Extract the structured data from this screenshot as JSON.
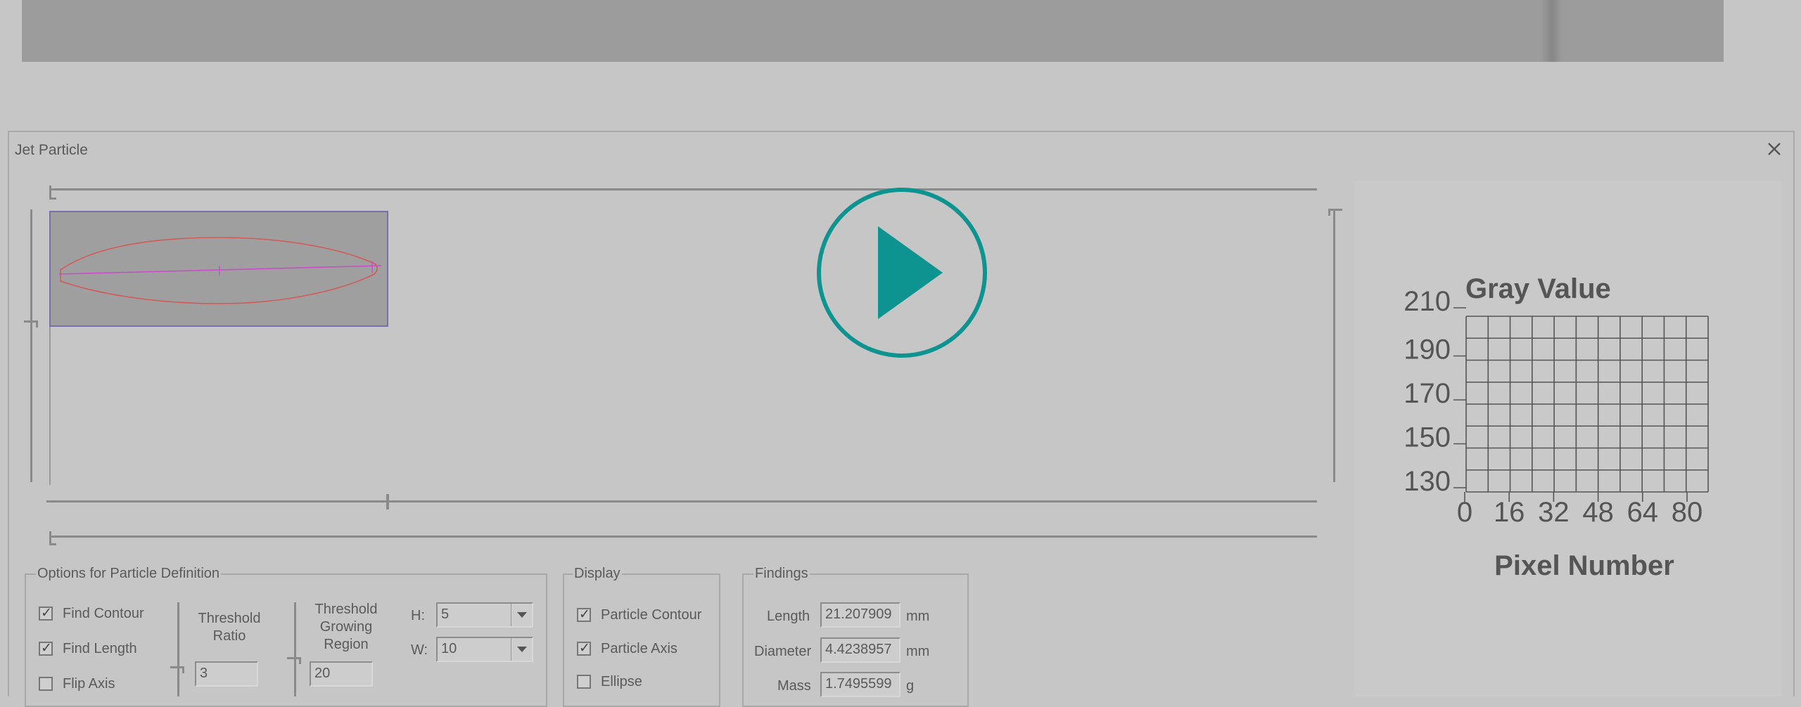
{
  "window": {
    "title": "Jet Particle"
  },
  "icons": {
    "close": "close-icon",
    "play": "play-icon",
    "checkmark": "✓"
  },
  "colors": {
    "play_accent": "#0e9490",
    "contour": "#d35a5a",
    "axis": "#c84fc8",
    "selection": "#7a6fa8"
  },
  "chart_data": {
    "type": "line",
    "title": "Gray Value",
    "xlabel": "Pixel Number",
    "ylabel": "",
    "x_ticks": [
      "0",
      "16",
      "32",
      "48",
      "64",
      "80"
    ],
    "y_ticks": [
      "210",
      "190",
      "170",
      "150",
      "130"
    ],
    "xlim": [
      0,
      80
    ],
    "ylim": [
      130,
      210
    ],
    "grid": true,
    "series": []
  },
  "options": {
    "legend": "Options for Particle Definition",
    "find_contour": {
      "label": "Find Contour",
      "checked": true
    },
    "find_length": {
      "label": "Find Length",
      "checked": true
    },
    "flip_axis": {
      "label": "Flip Axis",
      "checked": false
    },
    "threshold_ratio": {
      "label_line1": "Threshold",
      "label_line2": "Ratio",
      "value": "3"
    },
    "threshold_growing": {
      "label_line1": "Threshold",
      "label_line2": "Growing",
      "label_line3": "Region",
      "value": "20"
    },
    "h": {
      "label": "H:",
      "value": "5"
    },
    "w": {
      "label": "W:",
      "value": "10"
    }
  },
  "display": {
    "legend": "Display",
    "particle_contour": {
      "label": "Particle Contour",
      "checked": true
    },
    "particle_axis": {
      "label": "Particle Axis",
      "checked": true
    },
    "ellipse": {
      "label": "Ellipse",
      "checked": false
    }
  },
  "findings": {
    "legend": "Findings",
    "length": {
      "label": "Length",
      "value": "21.207909",
      "unit": "mm"
    },
    "diameter": {
      "label": "Diameter",
      "value": "4.4238957",
      "unit": "mm"
    },
    "mass": {
      "label": "Mass",
      "value": "1.7495599",
      "unit": "g"
    }
  }
}
